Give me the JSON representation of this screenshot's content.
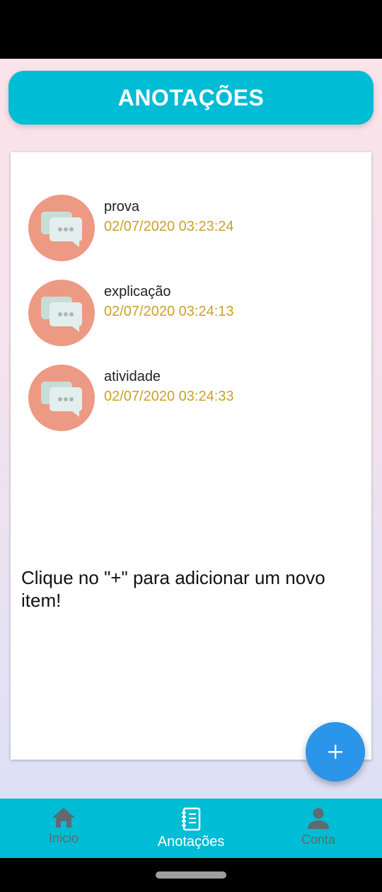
{
  "header": {
    "title": "ANOTAÇÕES"
  },
  "notes": [
    {
      "title": "prova",
      "date": "02/07/2020 03:23:24"
    },
    {
      "title": "explicação",
      "date": "02/07/2020 03:24:13"
    },
    {
      "title": "atividade",
      "date": "02/07/2020 03:24:33"
    }
  ],
  "hint": "Clique no \"+\" para adicionar um novo item!",
  "fab": {
    "icon": "plus-icon"
  },
  "bottom_nav": [
    {
      "label": "Inicio",
      "icon": "home-icon",
      "active": false
    },
    {
      "label": "Anotações",
      "icon": "notebook-icon",
      "active": true
    },
    {
      "label": "Conta",
      "icon": "person-icon",
      "active": false
    }
  ],
  "colors": {
    "primary": "#00bcd4",
    "accent_fab": "#2b95ea",
    "date_text": "#c9a227",
    "avatar_bg": "#ec9a84"
  }
}
